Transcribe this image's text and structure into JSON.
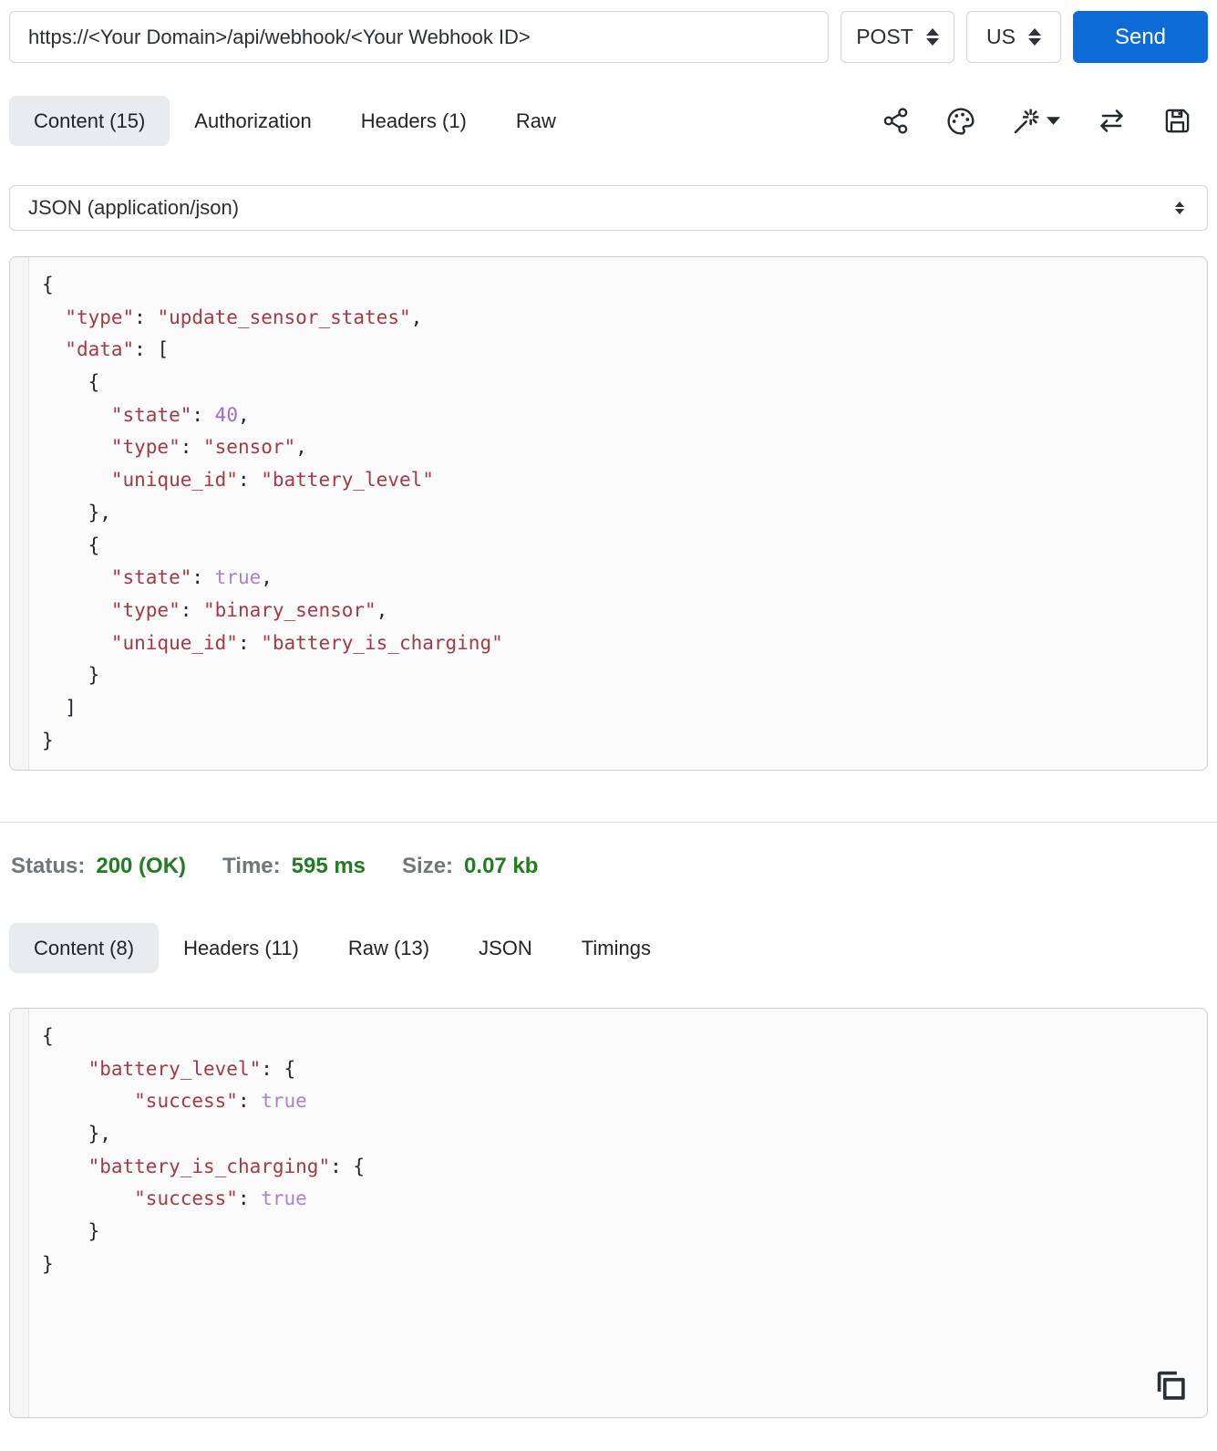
{
  "request_bar": {
    "url": "https://<Your Domain>/api/webhook/<Your Webhook ID>",
    "method": "POST",
    "region": "US",
    "send_label": "Send"
  },
  "request_tabs": [
    {
      "label": "Content (15)",
      "active": true
    },
    {
      "label": "Authorization",
      "active": false
    },
    {
      "label": "Headers (1)",
      "active": false
    },
    {
      "label": "Raw",
      "active": false
    }
  ],
  "toolbar": {
    "icons": [
      "share-icon",
      "palette-icon",
      "magic-wand-icon",
      "swap-arrows-icon",
      "save-icon"
    ]
  },
  "content_type": {
    "selected": "JSON (application/json)"
  },
  "request_body_lines": [
    [
      [
        "p",
        "{"
      ]
    ],
    [
      [
        "p",
        "  "
      ],
      [
        "s",
        "\"type\""
      ],
      [
        "p",
        ": "
      ],
      [
        "s",
        "\"update_sensor_states\""
      ],
      [
        "p",
        ","
      ]
    ],
    [
      [
        "p",
        "  "
      ],
      [
        "s",
        "\"data\""
      ],
      [
        "p",
        ": ["
      ]
    ],
    [
      [
        "p",
        "    {"
      ]
    ],
    [
      [
        "p",
        "      "
      ],
      [
        "s",
        "\"state\""
      ],
      [
        "p",
        ": "
      ],
      [
        "n",
        "40"
      ],
      [
        "p",
        ","
      ]
    ],
    [
      [
        "p",
        "      "
      ],
      [
        "s",
        "\"type\""
      ],
      [
        "p",
        ": "
      ],
      [
        "s",
        "\"sensor\""
      ],
      [
        "p",
        ","
      ]
    ],
    [
      [
        "p",
        "      "
      ],
      [
        "s",
        "\"unique_id\""
      ],
      [
        "p",
        ": "
      ],
      [
        "s",
        "\"battery_level\""
      ]
    ],
    [
      [
        "p",
        "    },"
      ]
    ],
    [
      [
        "p",
        "    {"
      ]
    ],
    [
      [
        "p",
        "      "
      ],
      [
        "s",
        "\"state\""
      ],
      [
        "p",
        ": "
      ],
      [
        "b",
        "true"
      ],
      [
        "p",
        ","
      ]
    ],
    [
      [
        "p",
        "      "
      ],
      [
        "s",
        "\"type\""
      ],
      [
        "p",
        ": "
      ],
      [
        "s",
        "\"binary_sensor\""
      ],
      [
        "p",
        ","
      ]
    ],
    [
      [
        "p",
        "      "
      ],
      [
        "s",
        "\"unique_id\""
      ],
      [
        "p",
        ": "
      ],
      [
        "s",
        "\"battery_is_charging\""
      ]
    ],
    [
      [
        "p",
        "    }"
      ]
    ],
    [
      [
        "p",
        "  ]"
      ]
    ],
    [
      [
        "p",
        "}"
      ]
    ]
  ],
  "status": {
    "status_label": "Status:",
    "status_value": "200 (OK)",
    "time_label": "Time:",
    "time_value": "595 ms",
    "size_label": "Size:",
    "size_value": "0.07 kb"
  },
  "response_tabs": [
    {
      "label": "Content (8)",
      "active": true
    },
    {
      "label": "Headers (11)",
      "active": false
    },
    {
      "label": "Raw (13)",
      "active": false
    },
    {
      "label": "JSON",
      "active": false
    },
    {
      "label": "Timings",
      "active": false
    }
  ],
  "response_body_lines": [
    [
      [
        "p",
        "{"
      ]
    ],
    [
      [
        "p",
        "    "
      ],
      [
        "s",
        "\"battery_level\""
      ],
      [
        "p",
        ": {"
      ]
    ],
    [
      [
        "p",
        "        "
      ],
      [
        "s",
        "\"success\""
      ],
      [
        "p",
        ": "
      ],
      [
        "b",
        "true"
      ]
    ],
    [
      [
        "p",
        "    },"
      ]
    ],
    [
      [
        "p",
        "    "
      ],
      [
        "s",
        "\"battery_is_charging\""
      ],
      [
        "p",
        ": {"
      ]
    ],
    [
      [
        "p",
        "        "
      ],
      [
        "s",
        "\"success\""
      ],
      [
        "p",
        ": "
      ],
      [
        "b",
        "true"
      ]
    ],
    [
      [
        "p",
        "    }"
      ]
    ],
    [
      [
        "p",
        "}"
      ]
    ]
  ],
  "colors": {
    "accent_blue": "#0d6cd8",
    "tab_active_bg": "#e9ecef",
    "status_green": "#237c23",
    "status_gray": "#71767a",
    "code_string": "#a33a44",
    "code_number": "#9d6ec5",
    "code_bool": "#ab82cf",
    "code_punct": "#22272e"
  }
}
